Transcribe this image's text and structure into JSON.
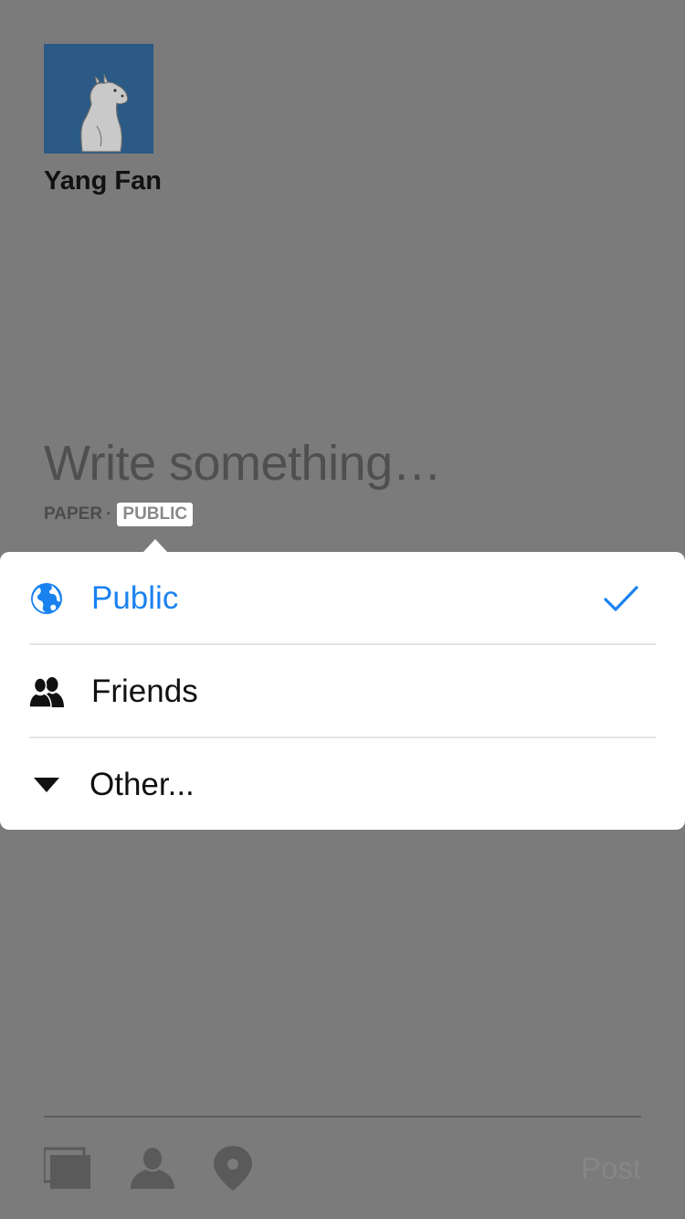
{
  "user": {
    "name": "Yang Fan"
  },
  "composer": {
    "placeholder": "Write something…",
    "source_label": "PAPER",
    "separator": "·",
    "privacy_label": "PUBLIC"
  },
  "privacy_menu": {
    "options": [
      {
        "label": "Public",
        "icon": "globe-icon",
        "selected": true
      },
      {
        "label": "Friends",
        "icon": "friends-icon",
        "selected": false
      },
      {
        "label": "Other...",
        "icon": "triangle-down-icon",
        "selected": false
      }
    ]
  },
  "toolbar": {
    "icons": [
      "photos-icon",
      "tag-person-icon",
      "location-pin-icon"
    ],
    "post_label": "Post"
  },
  "colors": {
    "accent": "#1a82f0",
    "overlay_background": "#7b7b7b",
    "popover_background": "#ffffff"
  }
}
